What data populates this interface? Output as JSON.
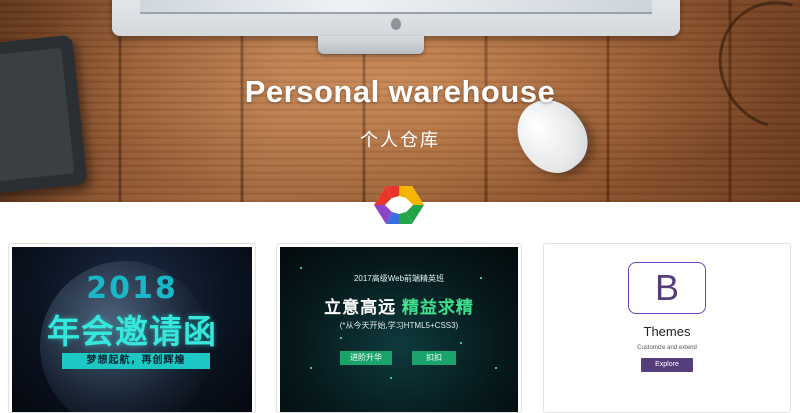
{
  "hero": {
    "title": "Personal warehouse",
    "subtitle": "个人仓库"
  },
  "logo": {
    "icon": "hexagon-logo-icon",
    "colors": [
      "#e8372a",
      "#f5b400",
      "#25a54a",
      "#3b6fe0",
      "#8e44c8"
    ]
  },
  "cards": [
    {
      "kind": "poster",
      "year": "2018",
      "title": "年会邀请函",
      "ribbon": "梦想起航，再创辉煌"
    },
    {
      "kind": "poster",
      "top_line": "2017高级Web前端精英班",
      "headline_a": "立意高远",
      "headline_b": "精益求精",
      "sub_line": "(*从今天开始,学习HTML5+CSS3)",
      "button_1": "进阶升华",
      "button_2": "扣扣"
    },
    {
      "kind": "theme",
      "logo_letter": "B",
      "title": "Themes",
      "description": "Customize and extend",
      "button": "Explore"
    }
  ],
  "colors": {
    "bootstrap_purple": "#563d7c",
    "poster_green": "#1aa36a",
    "poster_cyan": "#35e7dd"
  }
}
